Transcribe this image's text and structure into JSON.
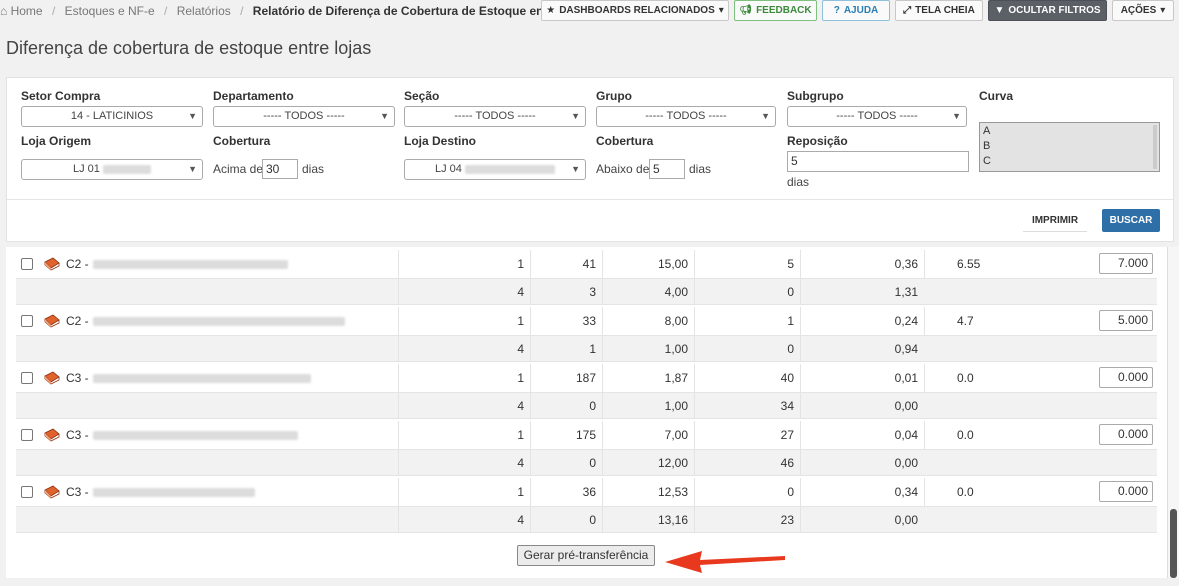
{
  "breadcrumb": {
    "home": "Home",
    "item1": "Estoques e NF-e",
    "item2": "Relatórios",
    "current": "Relatório de Diferença de Cobertura de Estoque entre Lojas"
  },
  "toolbar": {
    "dashboards": "DASHBOARDS RELACIONADOS",
    "feedback": "FEEDBACK",
    "help": "AJUDA",
    "fullscreen": "TELA CHEIA",
    "hide_filters": "OCULTAR FILTROS",
    "actions": "AÇÕES"
  },
  "page_title": "Diferença de cobertura de estoque entre lojas",
  "filters": {
    "setor_label": "Setor Compra",
    "setor_value": "14 - LATICINIOS",
    "departamento_label": "Departamento",
    "departamento_value": "----- TODOS -----",
    "secao_label": "Seção",
    "secao_value": "----- TODOS -----",
    "grupo_label": "Grupo",
    "grupo_value": "----- TODOS -----",
    "subgrupo_label": "Subgrupo",
    "subgrupo_value": "----- TODOS -----",
    "curva_label": "Curva",
    "curva_options": [
      "A",
      "B",
      "C"
    ],
    "loja_origem_label": "Loja Origem",
    "loja_origem_value": "LJ 01",
    "cobertura1_label": "Cobertura",
    "acima_de": "Acima de",
    "acima_value": "30",
    "dias1": "dias",
    "loja_destino_label": "Loja Destino",
    "loja_destino_value": "LJ 04",
    "cobertura2_label": "Cobertura",
    "abaixo_de": "Abaixo de",
    "abaixo_value": "5",
    "dias2": "dias",
    "reposicao_label": "Reposição",
    "reposicao_value": "5",
    "dias3": "dias",
    "print_label": "IMPRIMIR",
    "search_label": "BUSCAR"
  },
  "rows": [
    {
      "prefix": "C2 -",
      "main": [
        "1",
        "41",
        "15,00",
        "5",
        "0,36",
        "6.55"
      ],
      "qty": "7.000",
      "sub": [
        "4",
        "3",
        "4,00",
        "0",
        "1,31"
      ]
    },
    {
      "prefix": "C2 -",
      "main": [
        "1",
        "33",
        "8,00",
        "1",
        "0,24",
        "4.7"
      ],
      "qty": "5.000",
      "sub": [
        "4",
        "1",
        "1,00",
        "0",
        "0,94"
      ]
    },
    {
      "prefix": "C3 -",
      "main": [
        "1",
        "187",
        "1,87",
        "40",
        "0,01",
        "0.0"
      ],
      "qty": "0.000",
      "sub": [
        "4",
        "0",
        "1,00",
        "34",
        "0,00"
      ]
    },
    {
      "prefix": "C3 -",
      "main": [
        "1",
        "175",
        "7,00",
        "27",
        "0,04",
        "0.0"
      ],
      "qty": "0.000",
      "sub": [
        "4",
        "0",
        "12,00",
        "46",
        "0,00"
      ]
    },
    {
      "prefix": "C3 -",
      "main": [
        "1",
        "36",
        "12,53",
        "0",
        "0,34",
        "0.0"
      ],
      "qty": "0.000",
      "sub": [
        "4",
        "0",
        "13,16",
        "23",
        "0,00"
      ]
    }
  ],
  "generate_button": "Gerar pré-transferência",
  "colors": {
    "accent": "#2f6fa8",
    "annotation_arrow": "#e8391f",
    "book_icon": "#e0632e"
  }
}
